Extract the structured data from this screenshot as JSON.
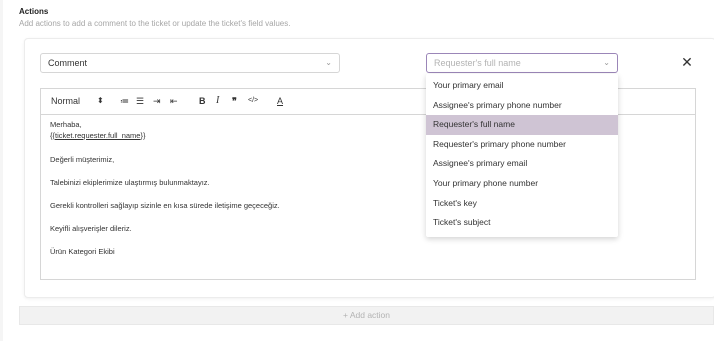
{
  "header": {
    "title": "Actions",
    "description": "Add actions to add a comment to the ticket or update the ticket's field values."
  },
  "action_row": {
    "action_select_value": "Comment",
    "field_select_placeholder": "Requester's full name",
    "close_label": "✕"
  },
  "toolbar": {
    "style_value": "Normal",
    "style_chevron": "⬍",
    "ordered_list_icon": "≔",
    "bullet_list_icon": "☰",
    "indent_icon": "⇥",
    "outdent_icon": "⇤",
    "bold": "B",
    "italic": "I",
    "quote": "❞",
    "code": "</>",
    "text_color": "A"
  },
  "editor": {
    "line1": "Merhaba,",
    "line2_prefix": "{{",
    "line2_link": "ticket.requester.full_name",
    "line2_suffix": "}}",
    "line3": "Değerli müşterimiz,",
    "line4": "Talebinizi ekiplerimize ulaştırmış bulunmaktayız.",
    "line5": "Gerekli kontrolleri sağlayıp sizinle en kısa sürede iletişime geçeceğiz.",
    "line6": "Keyifli alışverişler dileriz.",
    "line7": "Ürün Kategori Ekibi"
  },
  "dropdown": {
    "items": [
      {
        "label": "Your primary email"
      },
      {
        "label": "Assignee's primary phone number"
      },
      {
        "label": "Requester's full name",
        "selected": true
      },
      {
        "label": "Requester's primary phone number"
      },
      {
        "label": "Assignee's primary email"
      },
      {
        "label": "Your primary phone number"
      },
      {
        "label": "Ticket's key"
      },
      {
        "label": "Ticket's subject"
      }
    ]
  },
  "add_action": {
    "label": "+ Add action"
  },
  "colors": {
    "accent": "#9b86b8",
    "selected_bg": "#cfc4d4",
    "muted": "#a6a6a6"
  }
}
